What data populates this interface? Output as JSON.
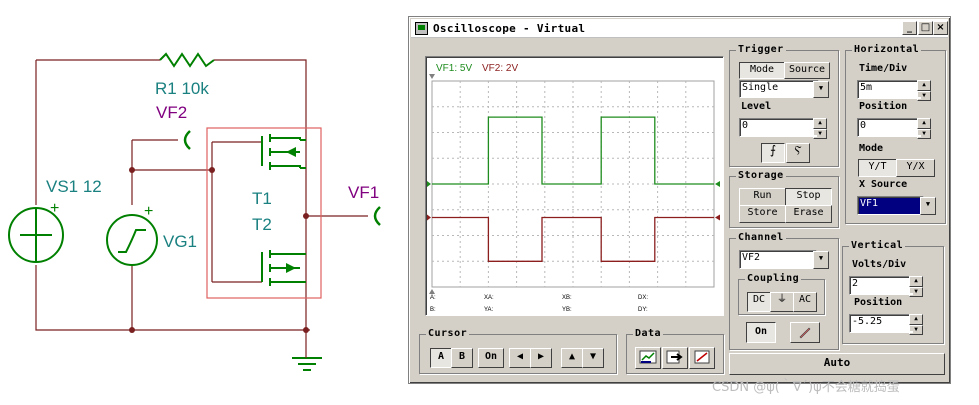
{
  "circuit": {
    "r1_label": "R1 10k",
    "vf2_label": "VF2",
    "vs1_label": "VS1 12",
    "vs1_plus": "+",
    "vg1_label": "VG1",
    "vg1_plus": "+",
    "t1_label": "T1",
    "t2_label": "T2",
    "vf1_label": "VF1",
    "colors": {
      "wire": "#7a2020",
      "component": "#008000",
      "label": "#1a8080",
      "probe": "#800080",
      "box": "#e06060"
    }
  },
  "window": {
    "title": "Oscilloscope - Virtual",
    "controls": {
      "minimize": "_",
      "maximize": "□",
      "close": "×"
    }
  },
  "screen": {
    "legend_vf1": "VF1: 5V",
    "legend_vf2": "VF2: 2V",
    "cursor_labels": {
      "a": "A:",
      "xa": "XA:",
      "xb": "XB:",
      "dx": "DX:",
      "b": "B:",
      "ya": "YA:",
      "yb": "YB:",
      "dy": "DY:"
    }
  },
  "chart_data": {
    "type": "line",
    "title": "",
    "xlabel": "",
    "ylabel": "",
    "grid": true,
    "x_divisions": 10,
    "y_divisions": 8,
    "series": [
      {
        "name": "VF1: 5V",
        "color": "#1e8c1e",
        "points": [
          [
            0,
            4.0
          ],
          [
            2.0,
            4.0
          ],
          [
            2.0,
            6.6
          ],
          [
            3.9,
            6.6
          ],
          [
            3.9,
            4.0
          ],
          [
            6.0,
            4.0
          ],
          [
            6.0,
            6.6
          ],
          [
            7.9,
            6.6
          ],
          [
            7.9,
            4.0
          ],
          [
            10,
            4.0
          ]
        ]
      },
      {
        "name": "VF2: 2V",
        "color": "#8c1e1e",
        "points": [
          [
            0,
            2.7
          ],
          [
            2.0,
            2.7
          ],
          [
            2.0,
            1.0
          ],
          [
            3.9,
            1.0
          ],
          [
            3.9,
            2.7
          ],
          [
            6.0,
            2.7
          ],
          [
            6.0,
            1.0
          ],
          [
            7.9,
            1.0
          ],
          [
            7.9,
            2.7
          ],
          [
            10,
            2.7
          ]
        ]
      }
    ]
  },
  "trigger": {
    "title": "Trigger",
    "mode_label": "Mode",
    "source_label": "Source",
    "mode_value": "Single",
    "level_label": "Level",
    "level_value": "0",
    "edge_rising": "⨍",
    "edge_falling": "Ⲋ"
  },
  "horizontal": {
    "title": "Horizontal",
    "time_div_label": "Time/Div",
    "time_div_value": "5m",
    "position_label": "Position",
    "position_value": "0",
    "mode_label": "Mode",
    "yt_label": "Y/T",
    "yx_label": "Y/X",
    "xsource_label": "X Source",
    "xsource_value": "VF1"
  },
  "storage": {
    "title": "Storage",
    "run_label": "Run",
    "stop_label": "Stop",
    "store_label": "Store",
    "erase_label": "Erase"
  },
  "channel": {
    "title": "Channel",
    "value": "VF2",
    "coupling_label": "Coupling",
    "dc_label": "DC",
    "gnd_label": "⏚",
    "ac_label": "AC",
    "on_label": "On"
  },
  "vertical": {
    "title": "Vertical",
    "volts_div_label": "Volts/Div",
    "volts_div_value": "2",
    "position_label": "Position",
    "position_value": "-5.25"
  },
  "cursor": {
    "title": "Cursor",
    "a_label": "A",
    "b_label": "B",
    "on_label": "On",
    "left": "◀",
    "right": "▶",
    "up": "▲",
    "down": "▼"
  },
  "data_group": {
    "title": "Data"
  },
  "auto_label": "Auto",
  "watermark": "CSDN @ψ(｀∇´)ψ不会糖就捣蛋"
}
